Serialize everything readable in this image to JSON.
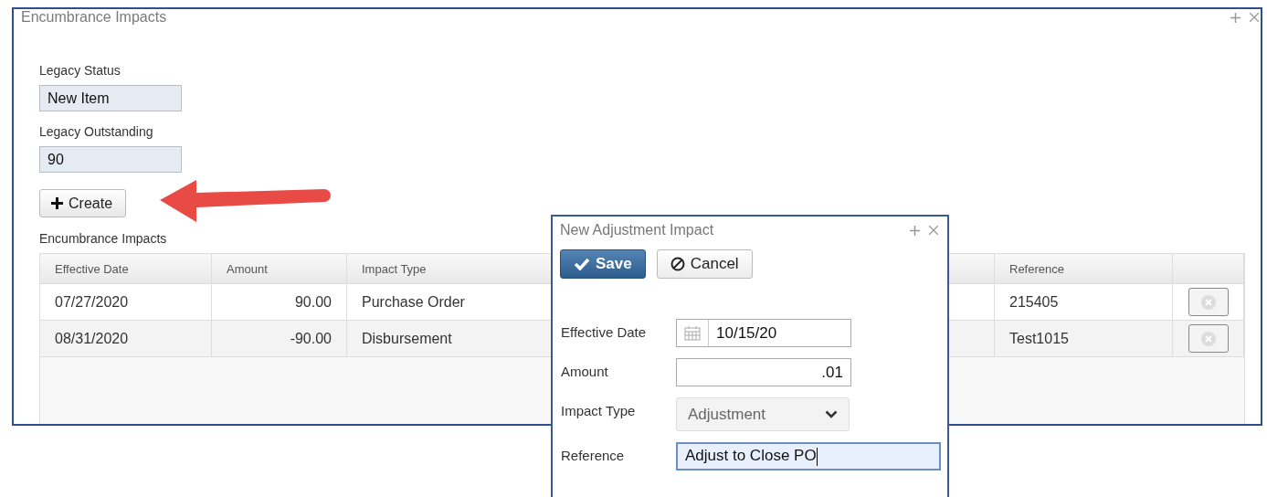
{
  "window": {
    "title": "Encumbrance Impacts"
  },
  "legacy_status": {
    "label": "Legacy Status",
    "value": "New Item"
  },
  "legacy_outstanding": {
    "label": "Legacy Outstanding",
    "value": "90"
  },
  "create_button": {
    "label": "Create"
  },
  "impacts_table": {
    "title": "Encumbrance Impacts",
    "columns": [
      "Effective Date",
      "Amount",
      "Impact Type",
      "Reference"
    ],
    "rows": [
      {
        "effective_date": "07/27/2020",
        "amount": "90.00",
        "impact_type": "Purchase Order",
        "reference": "215405"
      },
      {
        "effective_date": "08/31/2020",
        "amount": "-90.00",
        "impact_type": "Disbursement",
        "reference": "Test1015"
      }
    ]
  },
  "dialog": {
    "title": "New Adjustment Impact",
    "buttons": [
      {
        "kind": "primary",
        "label": "Save"
      },
      {
        "kind": "secondary",
        "label": "Cancel"
      }
    ],
    "fields": [
      {
        "kind": "date",
        "label": "Effective Date",
        "value": "10/15/20"
      },
      {
        "kind": "number",
        "label": "Amount",
        "value": ".01"
      },
      {
        "kind": "select",
        "label": "Impact Type",
        "value": "Adjustment"
      },
      {
        "kind": "text",
        "label": "Reference",
        "value": "Adjust to Close PO",
        "focused": true
      }
    ]
  }
}
